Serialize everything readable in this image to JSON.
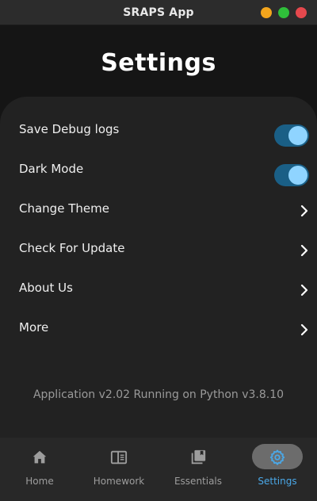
{
  "window": {
    "title": "SRAPS App"
  },
  "page": {
    "title": "Settings"
  },
  "settings": {
    "items": [
      {
        "label": "Save Debug logs",
        "type": "toggle",
        "value": true
      },
      {
        "label": "Dark Mode",
        "type": "toggle",
        "value": true
      },
      {
        "label": "Change Theme",
        "type": "link",
        "icon": "chevron-right-icon"
      },
      {
        "label": "Check For Update",
        "type": "link",
        "icon": "chevron-right-icon"
      },
      {
        "label": "About Us",
        "type": "link",
        "icon": "chevron-right-icon"
      },
      {
        "label": "More",
        "type": "link",
        "icon": "chevron-right-icon"
      }
    ],
    "version_text": "Application v2.02 Running on Python v3.8.10"
  },
  "nav": {
    "items": [
      {
        "label": "Home",
        "icon": "home-icon",
        "active": false
      },
      {
        "label": "Homework",
        "icon": "book-open-icon",
        "active": false
      },
      {
        "label": "Essentials",
        "icon": "library-books-icon",
        "active": false
      },
      {
        "label": "Settings",
        "icon": "gear-icon",
        "active": true
      }
    ]
  },
  "colors": {
    "background": "#151515",
    "card": "#222222",
    "toggle_track": "#1a5f86",
    "toggle_knob": "#8fd4ff",
    "accent": "#4aa8e8",
    "nav_active_pill": "#6c6c6c"
  }
}
